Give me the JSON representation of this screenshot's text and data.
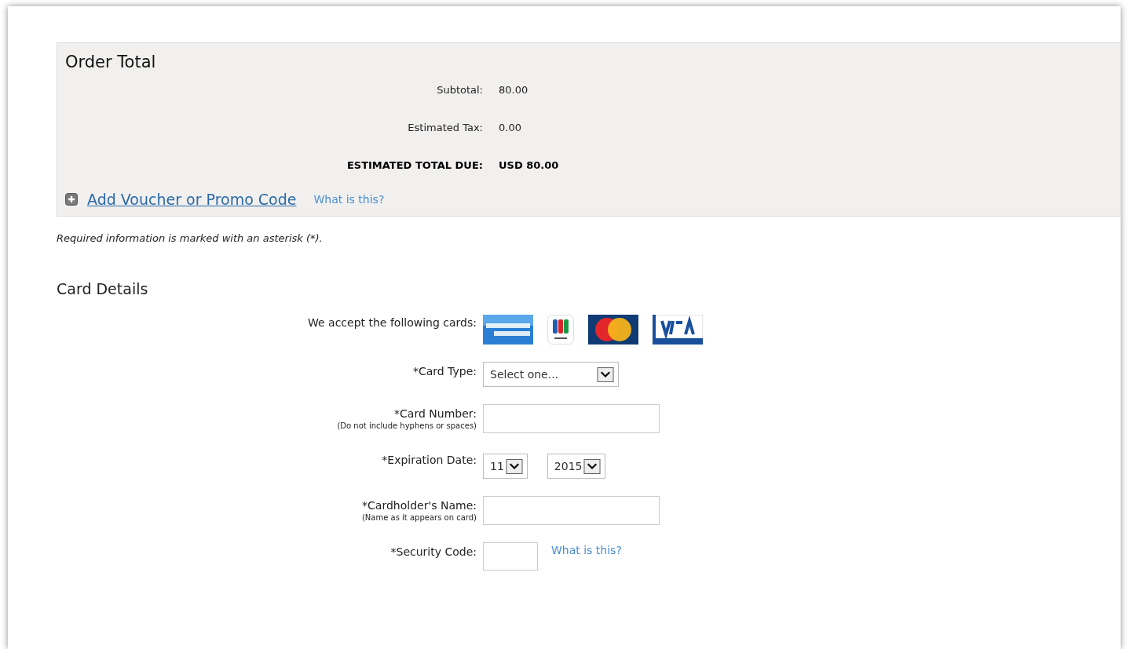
{
  "order_total": {
    "title": "Order Total",
    "rows": [
      {
        "kind": "normal",
        "label": "Subtotal:",
        "value": "80.00"
      },
      {
        "kind": "normal",
        "label": "Estimated Tax:",
        "value": "0.00"
      },
      {
        "kind": "total",
        "label": "ESTIMATED TOTAL DUE:",
        "value": "USD 80.00"
      }
    ],
    "voucher": {
      "link": "Add Voucher or Promo Code",
      "help": "What is this?"
    }
  },
  "required_note": "Required information is marked with an asterisk (*).",
  "card_details": {
    "title": "Card Details",
    "accepted_label": "We accept the following cards:",
    "cards": [
      {
        "kind": "amex"
      },
      {
        "kind": "jcb"
      },
      {
        "kind": "mastercard"
      },
      {
        "kind": "visa"
      }
    ],
    "fields": [
      {
        "kind": "select",
        "label": "*Card Type:",
        "value": "Select one..."
      },
      {
        "kind": "text",
        "label": "*Card Number:",
        "hint": "(Do not include hyphens or spaces)"
      },
      {
        "kind": "date",
        "label": "*Expiration Date:",
        "selects": [
          {
            "value": "11"
          },
          {
            "value": "2015"
          }
        ]
      },
      {
        "kind": "text",
        "label": "*Cardholder's Name:",
        "hint": "(Name as it appears on card)"
      },
      {
        "kind": "code",
        "label": "*Security Code:",
        "help": "What is this?"
      }
    ]
  }
}
